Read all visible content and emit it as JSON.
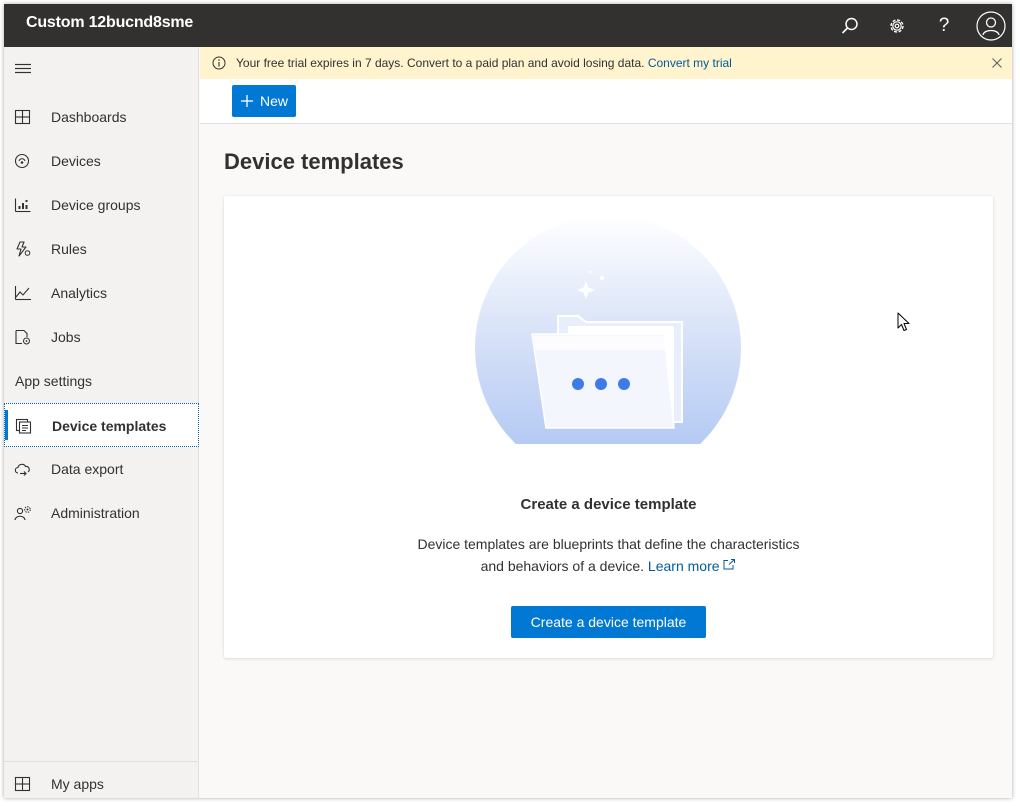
{
  "topbar": {
    "app_title": "Custom 12bucnd8sme",
    "icons": [
      "search-icon",
      "gear-icon",
      "help-icon",
      "user-avatar-icon"
    ],
    "help_glyph": "?"
  },
  "sidebar": {
    "items": [
      {
        "label": "Dashboards",
        "icon": "dashboard-icon"
      },
      {
        "label": "Devices",
        "icon": "devices-icon"
      },
      {
        "label": "Device groups",
        "icon": "device-groups-icon"
      },
      {
        "label": "Rules",
        "icon": "rules-icon"
      },
      {
        "label": "Analytics",
        "icon": "analytics-icon"
      },
      {
        "label": "Jobs",
        "icon": "jobs-icon"
      }
    ],
    "section_label": "App settings",
    "settings_items": [
      {
        "label": "Device templates",
        "icon": "device-templates-icon",
        "selected": true
      },
      {
        "label": "Data export",
        "icon": "data-export-icon"
      },
      {
        "label": "Administration",
        "icon": "administration-icon"
      }
    ],
    "bottom_item": {
      "label": "My apps",
      "icon": "my-apps-icon"
    }
  },
  "banner": {
    "message": "Your free trial expires in 7 days. Convert to a paid plan and avoid losing data.",
    "link_label": "Convert my trial",
    "background": "#fff4ce"
  },
  "commandbar": {
    "new_label": "New"
  },
  "page": {
    "title": "Device templates"
  },
  "empty_state": {
    "title": "Create a device template",
    "description_line1": "Device templates are blueprints that define the characteristics",
    "description_line2": "and behaviors of a device.",
    "learn_more_label": "Learn more",
    "button_label": "Create a device template"
  },
  "colors": {
    "accent": "#0078d4",
    "topbar": "#323130",
    "link": "#005a9e"
  }
}
